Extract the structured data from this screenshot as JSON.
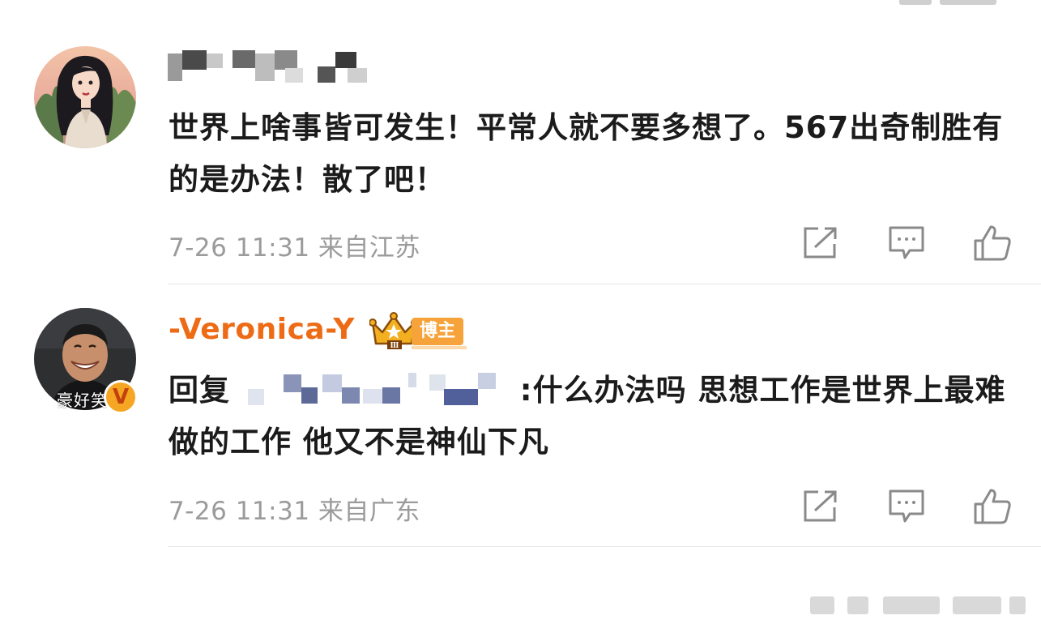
{
  "colors": {
    "accent_orange": "#ee6b16",
    "tag_bg": "#f7a33b",
    "meta_gray": "#9b9b9b",
    "text_dark": "#1b1b1b",
    "divider": "#e6e6e6",
    "verified_badge": "#f5a623"
  },
  "comments": [
    {
      "username_masked": true,
      "text": "世界上啥事皆可发生！平常人就不要多想了。567出奇制胜有的是办法！散了吧！",
      "meta": "7-26 11:31 来自江苏",
      "actions": [
        "share-icon",
        "comment-icon",
        "like-icon"
      ]
    },
    {
      "username": "-Veronica-Y",
      "badge_icon": "crown-icon",
      "badge_level": "Ⅲ",
      "tag": "博主",
      "avatar_caption": "豪好笑",
      "verified_mark": "V",
      "reply_prefix": "回复",
      "reply_text": ":什么办法吗 思想工作是世界上最难做的工作 他又不是神仙下凡",
      "meta": "7-26 11:31 来自广东",
      "actions": [
        "share-icon",
        "comment-icon",
        "like-icon"
      ]
    }
  ]
}
